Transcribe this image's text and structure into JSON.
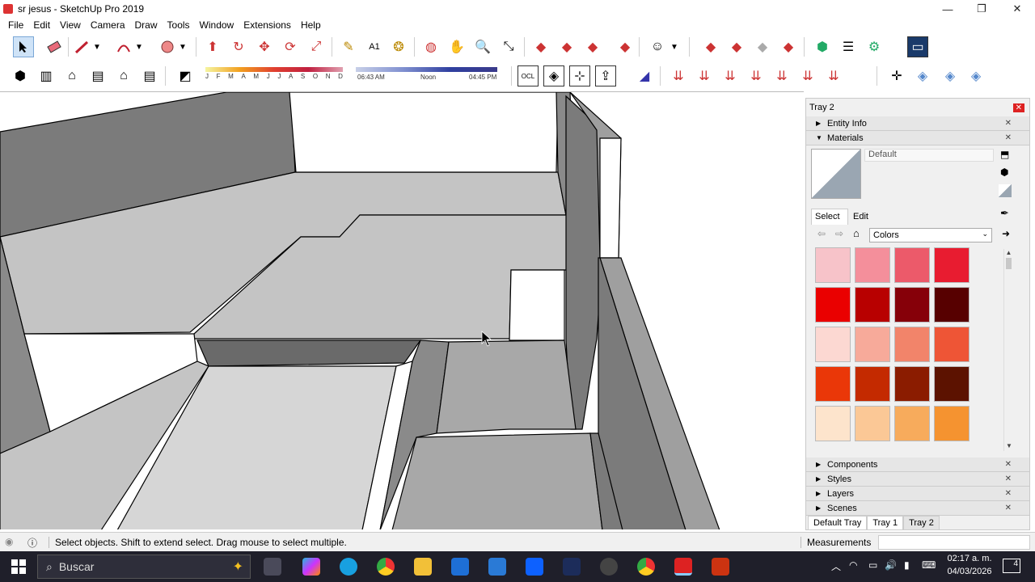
{
  "window": {
    "title": "sr jesus - SketchUp Pro 2019",
    "controls": {
      "minimize": "—",
      "restore": "❐",
      "close": "✕"
    }
  },
  "menu": [
    "File",
    "Edit",
    "View",
    "Camera",
    "Draw",
    "Tools",
    "Window",
    "Extensions",
    "Help"
  ],
  "shadow_settings": {
    "months": [
      "J",
      "F",
      "M",
      "A",
      "M",
      "J",
      "J",
      "A",
      "S",
      "O",
      "N",
      "D"
    ],
    "time_start": "06:43 AM",
    "time_mid": "Noon",
    "time_end": "04:45 PM"
  },
  "tray": {
    "title": "Tray 2",
    "close": "✕",
    "panels_top": [
      {
        "label": "Entity Info",
        "expanded": false
      },
      {
        "label": "Materials",
        "expanded": true
      }
    ],
    "material_name": "Default",
    "tabs": {
      "select": "Select",
      "edit": "Edit"
    },
    "library": "Colors",
    "swatches": [
      "#f7c3c9",
      "#f48f9b",
      "#ec5a6a",
      "#e81c30",
      "#ea0000",
      "#b80000",
      "#860009",
      "#570000",
      "#fcd8d2",
      "#f7aa9a",
      "#f2846a",
      "#ee5536",
      "#ea3708",
      "#c42a00",
      "#8b1c00",
      "#5c1200",
      "#fde4cc",
      "#fbc896",
      "#f7ab5c",
      "#f59330"
    ],
    "panels_bottom": [
      {
        "label": "Components"
      },
      {
        "label": "Styles"
      },
      {
        "label": "Layers"
      },
      {
        "label": "Scenes"
      }
    ],
    "bottom_tabs": [
      "Default Tray",
      "Tray 1",
      "Tray 2"
    ]
  },
  "status": {
    "message": "Select objects. Shift to extend select. Drag mouse to select multiple.",
    "measurements_label": "Measurements"
  },
  "taskbar": {
    "search_placeholder": "Buscar",
    "time": "02:17 a. m.",
    "date": "04/03/2026",
    "notifications": "4"
  },
  "colors": {
    "face_light": "#c4c4c4",
    "face_mid": "#9f9f9f",
    "face_dark": "#7b7b7b",
    "taskbar_bg": "#1f1f2a"
  }
}
